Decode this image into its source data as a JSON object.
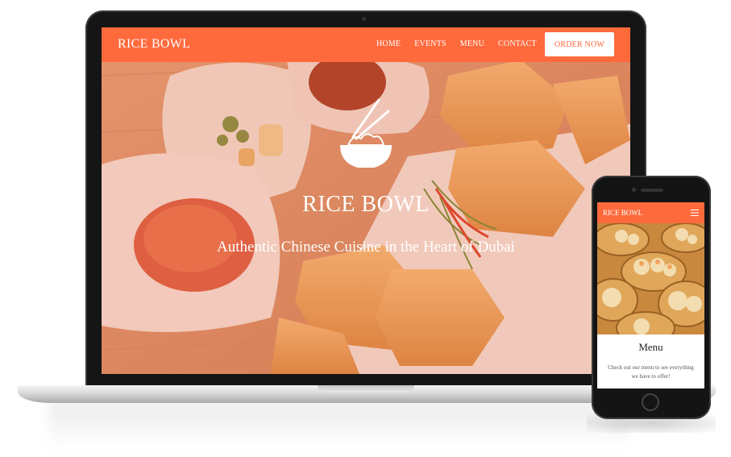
{
  "desktop": {
    "brand": "RICE BOWL",
    "nav": [
      "HOME",
      "EVENTS",
      "MENU",
      "CONTACT"
    ],
    "order_button": "ORDER NOW",
    "hero_title": "RICE BOWL",
    "hero_subtitle": "Authentic Chinese Cuisine in the Heart of Dubai"
  },
  "mobile": {
    "brand": "RICE BOWL",
    "section_title": "Menu",
    "section_text": "Check out our menu to see everything we have to offer!"
  },
  "colors": {
    "brand_orange": "#ff6a3d",
    "device_black": "#141414",
    "text_white": "#ffffff"
  },
  "icons": {
    "hero": "rice-bowl-chopsticks-icon",
    "mobile_menu": "hamburger-menu-icon"
  }
}
